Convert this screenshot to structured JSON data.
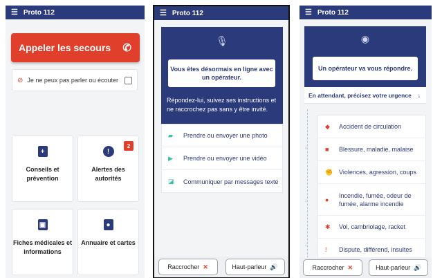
{
  "app_title": "Proto 112",
  "screen1": {
    "call_button": "Appeler les secours",
    "cant_speak_label": "Je ne peux pas parler ou écouter",
    "tiles": [
      {
        "label": "Conseils et prévention",
        "icon": "medical-book-icon"
      },
      {
        "label": "Alertes des autorités",
        "icon": "alert-icon",
        "badge": "2"
      },
      {
        "label": "Fiches médicales et informations",
        "icon": "id-badge-icon"
      },
      {
        "label": "Annuaire et cartes",
        "icon": "contact-card-icon"
      }
    ]
  },
  "screen2": {
    "status_text": "Vous êtes désormais en ligne avec un opérateur.",
    "instructions": "Répondez-lui, suivez ses instructions et ne raccrochez pas sans y être invité.",
    "actions": [
      {
        "label": "Prendre ou envoyer une photo",
        "icon": "camera-icon"
      },
      {
        "label": "Prendre ou envoyer une vidéo",
        "icon": "play-icon"
      },
      {
        "label": "Communiquer par messages texte",
        "icon": "message-icon"
      }
    ]
  },
  "screen3": {
    "status_text": "Un opérateur va vous répondre.",
    "waiting_prompt": "En attendant, précisez votre urgence",
    "urgencies": [
      {
        "label": "Accident de circulation",
        "icon": "car-crash-icon"
      },
      {
        "label": "Blessure, maladie, malaise",
        "icon": "ambulance-icon"
      },
      {
        "label": "Violences, agression, coups",
        "icon": "fist-icon"
      },
      {
        "label": "Incendie, fumée, odeur de fumée, alarme incendie",
        "icon": "fire-icon"
      },
      {
        "label": "Vol, cambriolage, racket",
        "icon": "running-thief-icon"
      },
      {
        "label": "Dispute, différend, insultes",
        "icon": "exclamation-icon"
      }
    ]
  },
  "bottom_bar": {
    "hangup": "Raccrocher",
    "speaker": "Haut-parleur"
  },
  "colors": {
    "primary": "#2b3a7a",
    "danger": "#e03f2c",
    "accent": "#3bbfa4"
  }
}
